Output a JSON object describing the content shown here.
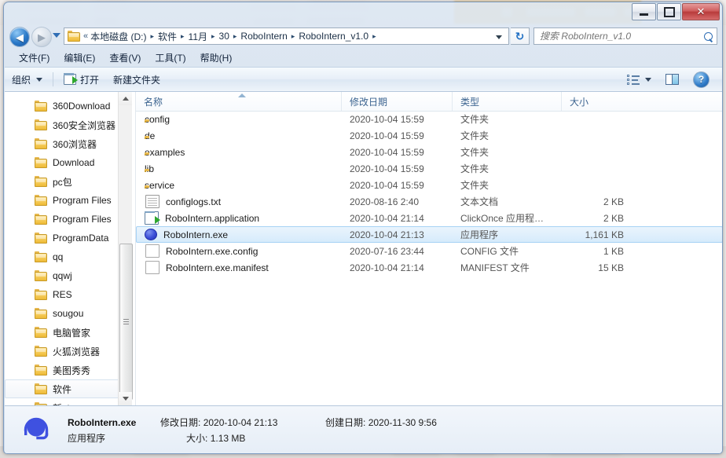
{
  "window": {
    "controls": {
      "minimize": "minimize-button",
      "maximize": "maximize-button",
      "close": "✕"
    }
  },
  "navigation": {
    "back_glyph": "◀",
    "forward_glyph": "▶",
    "chevrons": "«",
    "separator": "▸",
    "breadcrumbs": [
      "本地磁盘 (D:)",
      "软件",
      "11月",
      "30",
      "RoboIntern",
      "RoboIntern_v1.0"
    ],
    "refresh_glyph": "↻"
  },
  "search": {
    "placeholder": "搜索 RoboIntern_v1.0",
    "value": ""
  },
  "menu": {
    "items": [
      {
        "text": "文件(F)"
      },
      {
        "text": "编辑(E)"
      },
      {
        "text": "查看(V)"
      },
      {
        "text": "工具(T)"
      },
      {
        "text": "帮助(H)"
      }
    ]
  },
  "toolbar": {
    "organize": "组织",
    "open": "打开",
    "new_folder": "新建文件夹",
    "help_glyph": "?"
  },
  "tree": {
    "items": [
      {
        "label": "360Download",
        "selected": false
      },
      {
        "label": "360安全浏览器",
        "selected": false
      },
      {
        "label": "360浏览器",
        "selected": false
      },
      {
        "label": "Download",
        "selected": false
      },
      {
        "label": "pc包",
        "selected": false
      },
      {
        "label": "Program Files",
        "selected": false
      },
      {
        "label": "Program Files",
        "selected": false
      },
      {
        "label": "ProgramData",
        "selected": false
      },
      {
        "label": "qq",
        "selected": false
      },
      {
        "label": "qqwj",
        "selected": false
      },
      {
        "label": "RES",
        "selected": false
      },
      {
        "label": "sougou",
        "selected": false
      },
      {
        "label": "电脑管家",
        "selected": false
      },
      {
        "label": "火狐浏览器",
        "selected": false
      },
      {
        "label": "美图秀秀",
        "selected": false
      },
      {
        "label": "软件",
        "selected": true
      },
      {
        "label": "新obs",
        "selected": false
      }
    ]
  },
  "file_list": {
    "columns": {
      "name": "名称",
      "date": "修改日期",
      "type": "类型",
      "size": "大小"
    },
    "sort_column": "名称",
    "sort_direction": "ascending",
    "rows": [
      {
        "name": "config",
        "date": "2020-10-04 15:59",
        "type": "文件夹",
        "size": "",
        "icon": "folder",
        "selected": false
      },
      {
        "name": "de",
        "date": "2020-10-04 15:59",
        "type": "文件夹",
        "size": "",
        "icon": "folder",
        "selected": false
      },
      {
        "name": "examples",
        "date": "2020-10-04 15:59",
        "type": "文件夹",
        "size": "",
        "icon": "folder",
        "selected": false
      },
      {
        "name": "lib",
        "date": "2020-10-04 15:59",
        "type": "文件夹",
        "size": "",
        "icon": "folder",
        "selected": false
      },
      {
        "name": "service",
        "date": "2020-10-04 15:59",
        "type": "文件夹",
        "size": "",
        "icon": "folder",
        "selected": false
      },
      {
        "name": "configlogs.txt",
        "date": "2020-08-16 2:40",
        "type": "文本文档",
        "size": "2 KB",
        "icon": "txt",
        "selected": false
      },
      {
        "name": "RoboIntern.application",
        "date": "2020-10-04 21:14",
        "type": "ClickOnce 应用程…",
        "size": "2 KB",
        "icon": "clickonce",
        "selected": false
      },
      {
        "name": "RoboIntern.exe",
        "date": "2020-10-04 21:13",
        "type": "应用程序",
        "size": "1,161 KB",
        "icon": "exe",
        "selected": true
      },
      {
        "name": "RoboIntern.exe.config",
        "date": "2020-07-16 23:44",
        "type": "CONFIG 文件",
        "size": "1 KB",
        "icon": "blank",
        "selected": false
      },
      {
        "name": "RoboIntern.exe.manifest",
        "date": "2020-10-04 21:14",
        "type": "MANIFEST 文件",
        "size": "15 KB",
        "icon": "blank",
        "selected": false
      }
    ]
  },
  "details": {
    "filename": "RoboIntern.exe",
    "kind": "应用程序",
    "modified_label": "修改日期:",
    "modified_value": "2020-10-04 21:13",
    "created_label": "创建日期:",
    "created_value": "2020-11-30 9:56",
    "size_label": "大小:",
    "size_value": "1.13 MB"
  },
  "colors": {
    "selection_blue": "#d6ebfb",
    "accent_blue": "#2f6eb5",
    "close_red": "#b83b3b",
    "folder_yellow": "#eeba36",
    "exe_icon_blue": "#3b4fd8"
  }
}
